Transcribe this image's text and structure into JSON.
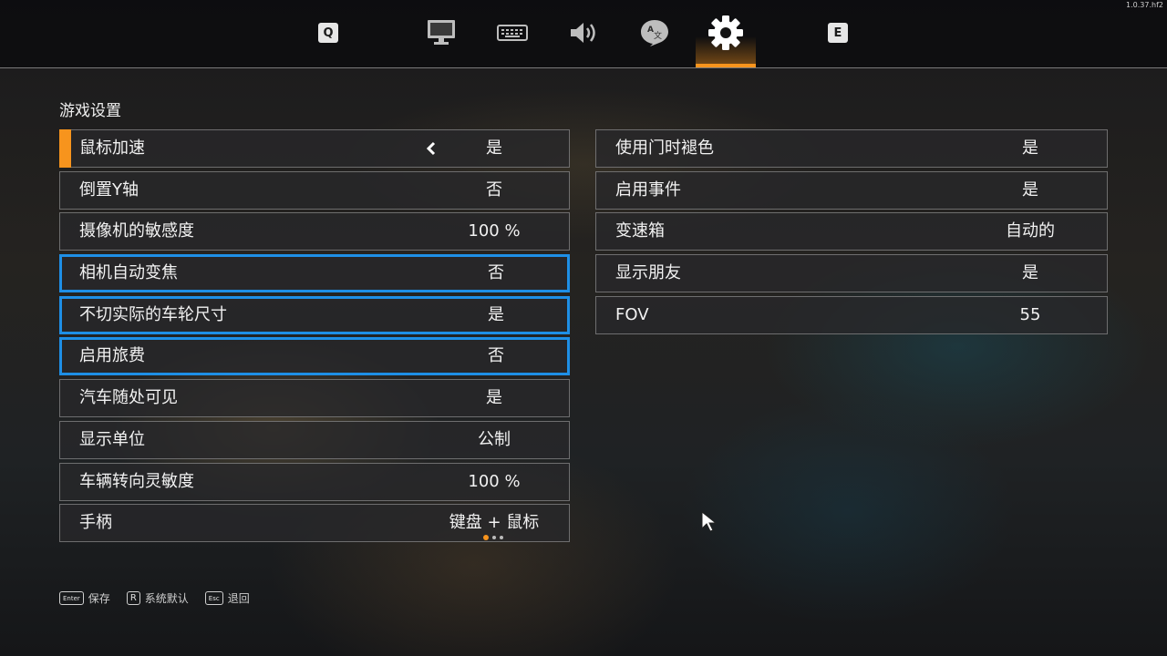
{
  "version": "1.0.37.hf2",
  "tabs": {
    "prev_key": "Q",
    "next_key": "E",
    "icons": [
      "monitor-icon",
      "keyboard-icon",
      "speaker-icon",
      "language-icon",
      "gear-icon"
    ],
    "active": "gear-icon"
  },
  "colors": {
    "accent": "#f7941d",
    "highlight": "#1e8fe6"
  },
  "section_title": "游戏设置",
  "left_settings": [
    {
      "label": "鼠标加速",
      "value": "是"
    },
    {
      "label": "倒置Y轴",
      "value": "否"
    },
    {
      "label": "摄像机的敏感度",
      "value": "100 %"
    },
    {
      "label": "相机自动变焦",
      "value": "否"
    },
    {
      "label": "不切实际的车轮尺寸",
      "value": "是"
    },
    {
      "label": "启用旅费",
      "value": "否"
    },
    {
      "label": "汽车随处可见",
      "value": "是"
    },
    {
      "label": "显示单位",
      "value": "公制"
    },
    {
      "label": "车辆转向灵敏度",
      "value": "100 %"
    },
    {
      "label": "手柄",
      "value": "键盘 + 鼠标"
    }
  ],
  "right_settings": [
    {
      "label": "使用门时褪色",
      "value": "是"
    },
    {
      "label": "启用事件",
      "value": "是"
    },
    {
      "label": "变速箱",
      "value": "自动的"
    },
    {
      "label": "显示朋友",
      "value": "是"
    },
    {
      "label": "FOV",
      "value": "55"
    }
  ],
  "footer": {
    "save_key": "Enter",
    "save_label": "保存",
    "default_key": "R",
    "default_label": "系统默认",
    "back_key": "Esc",
    "back_label": "退回"
  }
}
